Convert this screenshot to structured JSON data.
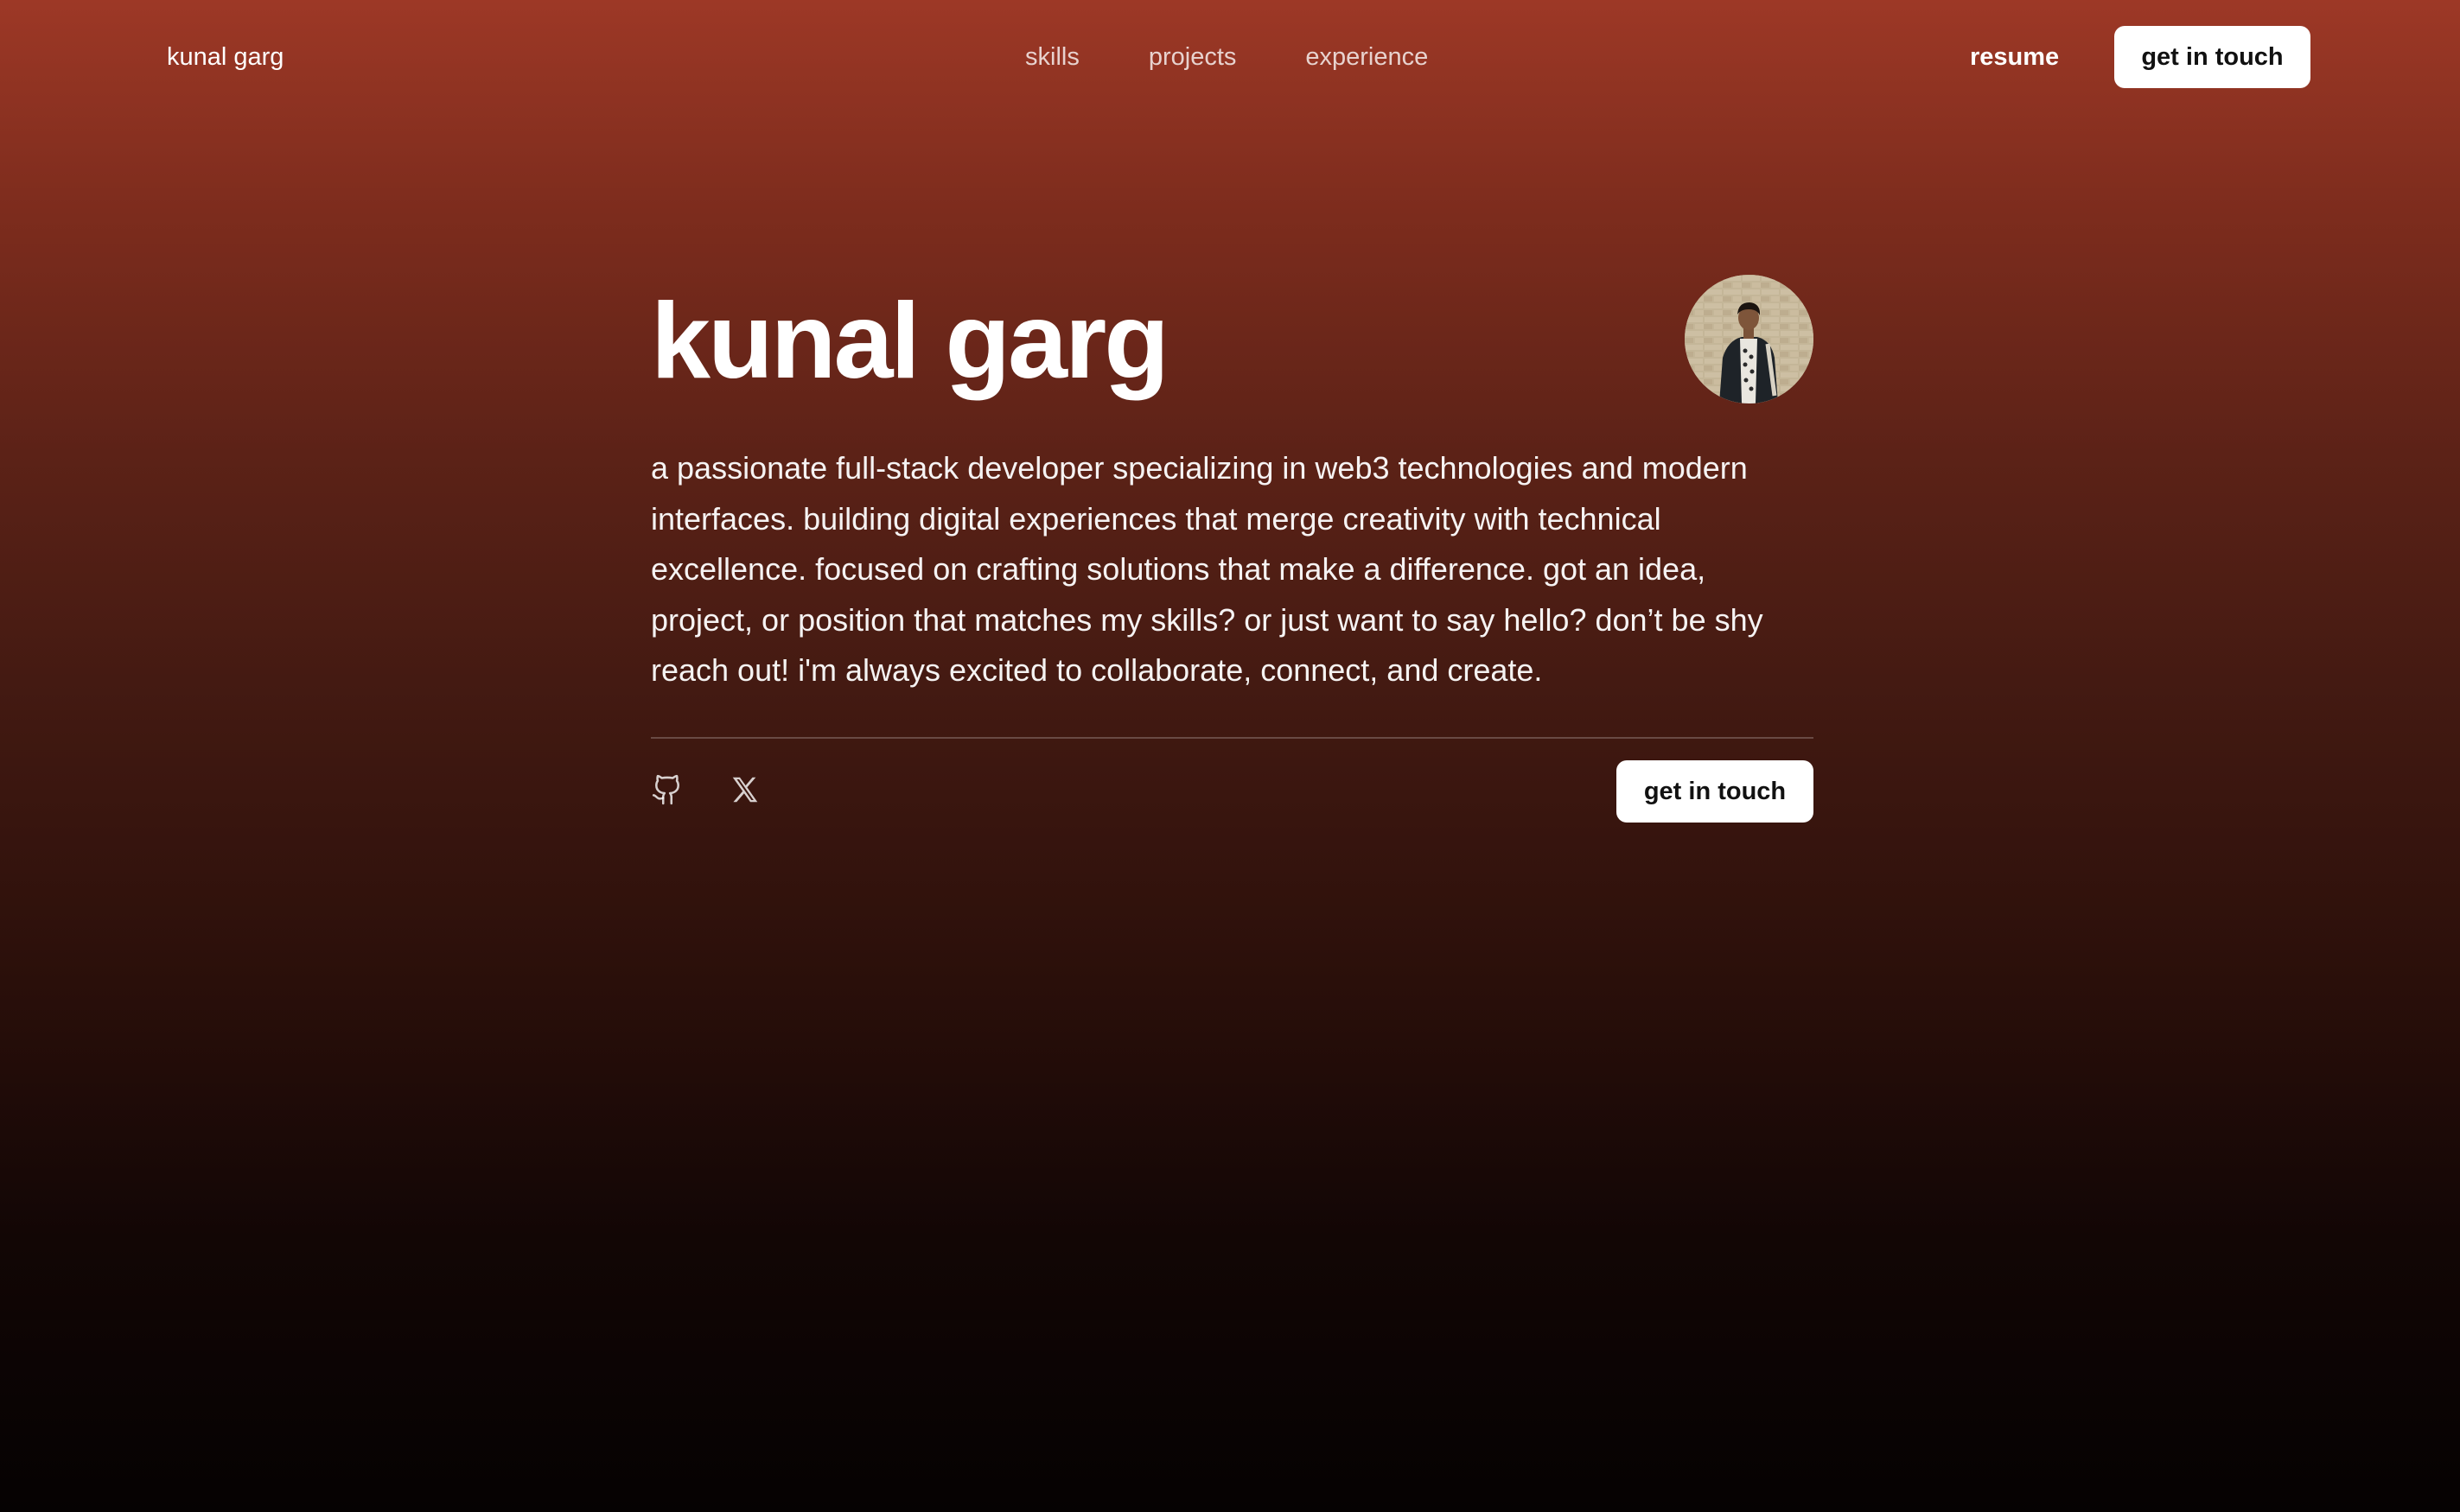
{
  "nav": {
    "brand": "kunal garg",
    "links": [
      {
        "label": "skills"
      },
      {
        "label": "projects"
      },
      {
        "label": "experience"
      }
    ],
    "resume_label": "resume",
    "cta_label": "get in touch"
  },
  "hero": {
    "name": "kunal garg",
    "avatar_icon": "profile-photo",
    "bio": "a passionate full-stack developer specializing in web3 technologies and modern interfaces. building digital experiences that merge creativity with technical excellence. focused on crafting solutions that make a difference. got an idea, project, or position that matches my skills? or just want to say hello? don’t be shy reach out! i'm always excited to collaborate, connect, and create.",
    "socials": [
      {
        "icon": "github-icon"
      },
      {
        "icon": "x-twitter-icon"
      }
    ],
    "cta_label": "get in touch"
  },
  "colors": {
    "gradient_top": "#9d3826",
    "gradient_bottom": "#050202",
    "button_bg": "#ffffff",
    "button_text": "#111111"
  }
}
